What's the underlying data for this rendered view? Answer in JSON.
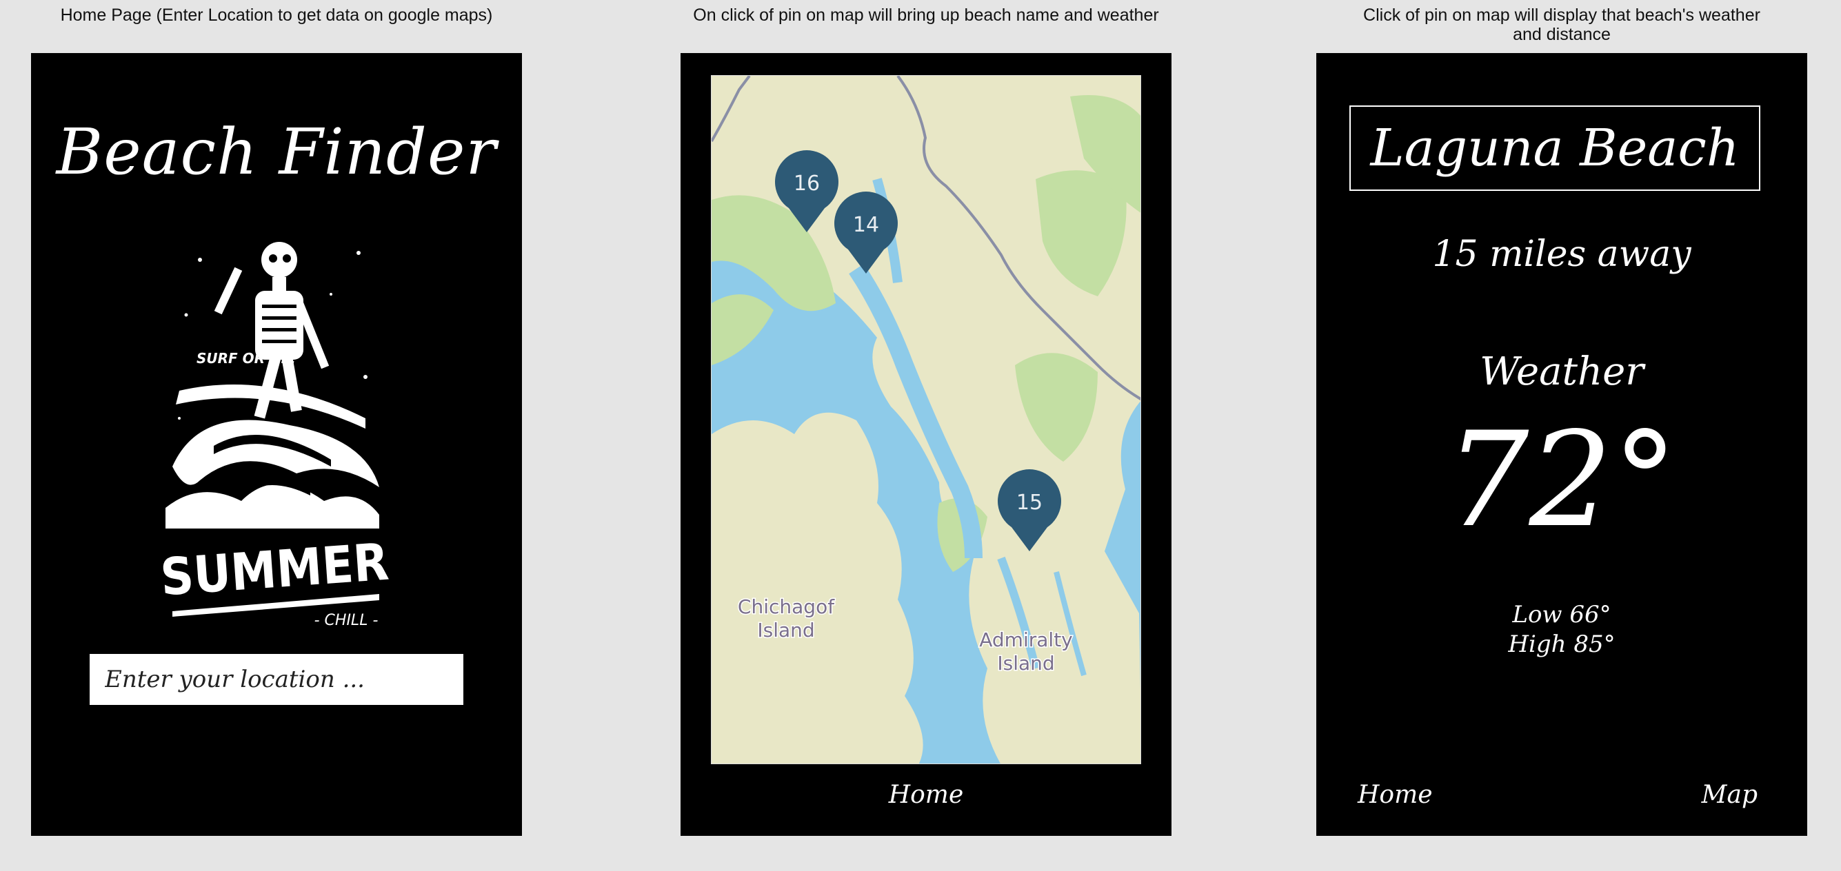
{
  "captions": {
    "home": "Home Page (Enter Location to get data on google maps)",
    "map": "On click of pin on map will bring up beach name and weather",
    "detail": "Click of pin on map will display that beach's weather and distance"
  },
  "home": {
    "title": "Beach Finder",
    "art": {
      "label_top": "SURF OR DIE",
      "label_main": "SUMMER",
      "label_sub": "- CHILL -"
    },
    "location_input": {
      "placeholder": "Enter your location ...",
      "value": ""
    }
  },
  "map": {
    "pins": [
      {
        "label": "16"
      },
      {
        "label": "14"
      },
      {
        "label": "15"
      }
    ],
    "places": [
      {
        "line1": "Chichagof",
        "line2": "Island"
      },
      {
        "line1": "Admiralty",
        "line2": "Island"
      }
    ],
    "nav_home": "Home",
    "colors": {
      "water": "#8ecbe9",
      "land": "#e8e7c6",
      "forest": "#c3dfa3",
      "pin": "#2d5a76"
    }
  },
  "detail": {
    "beach_name": "Laguna Beach",
    "distance": "15 miles away",
    "weather_label": "Weather",
    "temperature": "72°",
    "low": "Low 66°",
    "high": "High 85°",
    "nav_home": "Home",
    "nav_map": "Map"
  }
}
